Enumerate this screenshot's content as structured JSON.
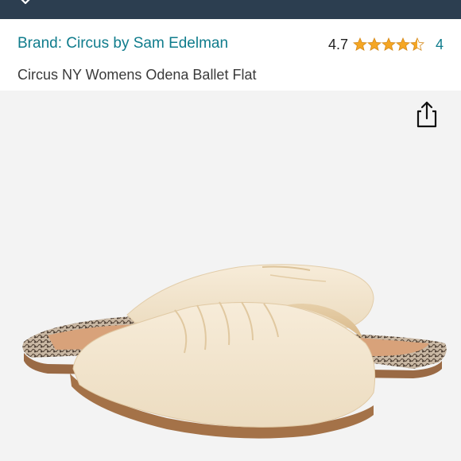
{
  "header": {
    "brand_link": "Brand: Circus by Sam Edelman",
    "rating_value": "4.7",
    "rating_stars": 4.5,
    "rating_count": "4"
  },
  "product": {
    "title": "Circus NY Womens Odena Ballet Flat"
  },
  "colors": {
    "topbar": "#2c3e50",
    "link": "#0f7c8c",
    "star": "#f5a623",
    "image_bg": "#f3f3f3"
  },
  "icons": {
    "topbar": "chevron-down-icon",
    "share": "share-icon",
    "rating": "star-icon"
  }
}
